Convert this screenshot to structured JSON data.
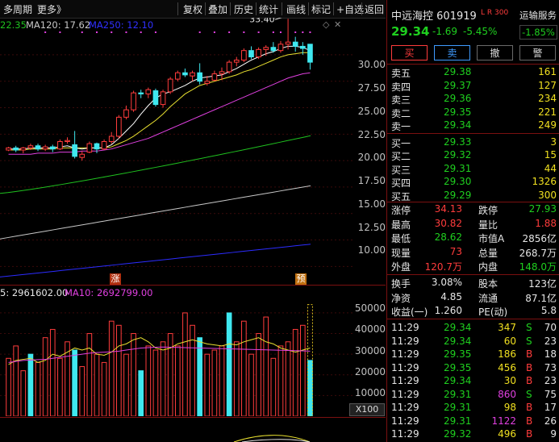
{
  "toolbar": {
    "left": [
      "多周期",
      "更多》"
    ],
    "right": [
      "复权",
      "叠加",
      "历史",
      "统计",
      "画线",
      "标记",
      "+自选",
      "返回"
    ]
  },
  "ma_legend": {
    "ma60_value": "22.35",
    "ma120": "MA120: 17.62",
    "ma250": "MA250: 12.10"
  },
  "price_axis": [
    "30.00",
    "27.50",
    "25.00",
    "22.50",
    "20.00",
    "17.50",
    "15.00",
    "12.50",
    "10.00"
  ],
  "annotations": {
    "high_label": "33.40",
    "marker_zhang": "涨",
    "marker_yu": "预"
  },
  "volume_legend": {
    "ma5": "5: 2961602.00",
    "ma10": "MA10: 2692799.00"
  },
  "volume_axis": [
    "50000",
    "40000",
    "30000",
    "20000",
    "10000"
  ],
  "volume_unit": "X100",
  "colors": {
    "up": "#ff3c3c",
    "down": "#3fe8f0",
    "ma5": "#ffffff",
    "ma10": "#e8e030",
    "ma20": "#e040e0",
    "ma60": "#1fc01f",
    "ma120": "#c8c8c8",
    "ma250": "#2c2cff"
  },
  "stock": {
    "name": "中远海控",
    "code": "601919",
    "flags": "L R",
    "flag_num": "300",
    "sector": "运输服务",
    "sector_change": "-1.85%",
    "price": "29.34",
    "change": "-1.69",
    "change_pct": "-5.45%"
  },
  "actions": [
    "买",
    "卖",
    "撤",
    "警"
  ],
  "asks": [
    {
      "label": "卖五",
      "price": "29.38",
      "vol": "161"
    },
    {
      "label": "卖四",
      "price": "29.37",
      "vol": "127"
    },
    {
      "label": "卖三",
      "price": "29.36",
      "vol": "234"
    },
    {
      "label": "卖二",
      "price": "29.35",
      "vol": "221"
    },
    {
      "label": "卖一",
      "price": "29.34",
      "vol": "249"
    }
  ],
  "bids": [
    {
      "label": "买一",
      "price": "29.33",
      "vol": "3"
    },
    {
      "label": "买二",
      "price": "29.32",
      "vol": "15"
    },
    {
      "label": "买三",
      "price": "29.31",
      "vol": "44"
    },
    {
      "label": "买四",
      "price": "29.30",
      "vol": "1326"
    },
    {
      "label": "买五",
      "price": "29.29",
      "vol": "300"
    }
  ],
  "stats": [
    {
      "l1": "涨停",
      "v1": "34.13",
      "c1": "red",
      "l2": "跌停",
      "v2": "27.93",
      "c2": "grn"
    },
    {
      "l1": "最高",
      "v1": "30.82",
      "c1": "red",
      "l2": "量比",
      "v2": "1.88",
      "c2": "red"
    },
    {
      "l1": "最低",
      "v1": "28.62",
      "c1": "grn",
      "l2": "市值A",
      "v2": "2856亿",
      "c2": "wht"
    },
    {
      "l1": "现量",
      "v1": "73",
      "c1": "red",
      "l2": "总量",
      "v2": "268.7万",
      "c2": "wht"
    },
    {
      "l1": "外盘",
      "v1": "120.7万",
      "c1": "red",
      "l2": "内盘",
      "v2": "148.0万",
      "c2": "grn"
    }
  ],
  "stats2": [
    {
      "l1": "换手",
      "v1": "3.08%",
      "l2": "股本",
      "v2": "123亿"
    },
    {
      "l1": "净资",
      "v1": "4.85",
      "l2": "流通",
      "v2": "87.1亿"
    },
    {
      "l1": "收益(一)",
      "v1": "1.260",
      "l2": "PE(动)",
      "v2": "5.8"
    }
  ],
  "ticks": [
    {
      "time": "11:29",
      "price": "29.34",
      "vol": "347",
      "side": "S",
      "n": "70",
      "vc": "yel",
      "sc": "grn"
    },
    {
      "time": "11:29",
      "price": "29.34",
      "vol": "60",
      "side": "S",
      "n": "23",
      "vc": "yel",
      "sc": "grn"
    },
    {
      "time": "11:29",
      "price": "29.35",
      "vol": "186",
      "side": "B",
      "n": "18",
      "vc": "yel",
      "sc": "red"
    },
    {
      "time": "11:29",
      "price": "29.35",
      "vol": "456",
      "side": "B",
      "n": "73",
      "vc": "yel",
      "sc": "red"
    },
    {
      "time": "11:29",
      "price": "29.34",
      "vol": "30",
      "side": "B",
      "n": "23",
      "vc": "yel",
      "sc": "red"
    },
    {
      "time": "11:29",
      "price": "29.31",
      "vol": "860",
      "side": "S",
      "n": "75",
      "vc": "mag",
      "sc": "grn"
    },
    {
      "time": "11:29",
      "price": "29.31",
      "vol": "98",
      "side": "B",
      "n": "17",
      "vc": "yel",
      "sc": "red"
    },
    {
      "time": "11:29",
      "price": "29.31",
      "vol": "1122",
      "side": "B",
      "n": "26",
      "vc": "mag",
      "sc": "red"
    },
    {
      "time": "11:29",
      "price": "29.32",
      "vol": "496",
      "side": "B",
      "n": "9",
      "vc": "yel",
      "sc": "red"
    }
  ],
  "chart_data": {
    "type": "candlestick",
    "price_ylim": [
      8.5,
      33.5
    ],
    "candles": [
      [
        21.0,
        21.3,
        20.9,
        21.2
      ],
      [
        21.2,
        21.4,
        20.8,
        21.0
      ],
      [
        21.0,
        21.3,
        20.7,
        21.2
      ],
      [
        21.2,
        21.6,
        21.0,
        21.4
      ],
      [
        21.4,
        21.6,
        20.9,
        21.1
      ],
      [
        21.1,
        21.5,
        20.9,
        21.3
      ],
      [
        21.3,
        21.5,
        20.8,
        21.1
      ],
      [
        21.1,
        22.0,
        21.0,
        21.8
      ],
      [
        21.8,
        22.2,
        21.6,
        21.9
      ],
      [
        21.5,
        22.8,
        20.2,
        20.4
      ],
      [
        20.3,
        20.9,
        20.0,
        20.6
      ],
      [
        20.8,
        21.8,
        20.7,
        21.6
      ],
      [
        21.6,
        21.7,
        20.7,
        21.1
      ],
      [
        21.1,
        22.0,
        21.0,
        21.8
      ],
      [
        21.8,
        22.7,
        21.6,
        22.3
      ],
      [
        22.3,
        24.3,
        22.1,
        24.1
      ],
      [
        24.1,
        25.2,
        23.9,
        24.8
      ],
      [
        24.8,
        26.6,
        24.6,
        26.4
      ],
      [
        26.4,
        26.7,
        25.9,
        26.3
      ],
      [
        26.3,
        26.9,
        25.9,
        26.7
      ],
      [
        26.6,
        26.8,
        25.1,
        25.3
      ],
      [
        25.3,
        26.7,
        25.0,
        26.5
      ],
      [
        26.5,
        27.9,
        26.3,
        27.7
      ],
      [
        27.7,
        28.5,
        27.5,
        28.3
      ],
      [
        28.3,
        28.7,
        27.9,
        28.1
      ],
      [
        28.0,
        28.5,
        27.5,
        28.3
      ],
      [
        28.3,
        29.2,
        27.2,
        27.5
      ],
      [
        27.3,
        28.0,
        27.1,
        27.5
      ],
      [
        27.6,
        28.5,
        27.5,
        28.2
      ],
      [
        28.2,
        28.8,
        27.6,
        28.4
      ],
      [
        28.4,
        29.5,
        28.2,
        29.3
      ],
      [
        29.3,
        29.8,
        28.9,
        29.5
      ],
      [
        29.5,
        30.6,
        29.3,
        30.4
      ],
      [
        30.4,
        30.8,
        29.6,
        29.8
      ],
      [
        29.8,
        30.7,
        29.6,
        30.5
      ],
      [
        30.5,
        30.9,
        29.9,
        30.7
      ],
      [
        30.7,
        31.2,
        30.2,
        30.4
      ],
      [
        30.4,
        31.3,
        30.2,
        31.0
      ],
      [
        31.0,
        33.4,
        30.5,
        31.2
      ],
      [
        31.2,
        31.7,
        30.3,
        30.8
      ],
      [
        30.8,
        31.2,
        30.0,
        30.6
      ],
      [
        31.0,
        31.0,
        28.6,
        29.3
      ]
    ],
    "ma5": [
      21.1,
      21.1,
      21.1,
      21.2,
      21.2,
      21.2,
      21.2,
      21.3,
      21.4,
      21.2,
      21.1,
      21.2,
      21.2,
      21.2,
      21.5,
      22.1,
      22.8,
      23.5,
      24.4,
      25.2,
      25.9,
      26.3,
      26.5,
      26.8,
      27.1,
      27.5,
      27.8,
      27.9,
      28.0,
      28.1,
      28.4,
      28.7,
      29.1,
      29.5,
      29.8,
      30.1,
      30.3,
      30.6,
      30.8,
      30.8,
      30.7,
      30.4
    ],
    "ma10": [
      21.0,
      21.0,
      21.0,
      21.1,
      21.1,
      21.1,
      21.1,
      21.2,
      21.2,
      21.2,
      21.2,
      21.2,
      21.2,
      21.2,
      21.3,
      21.6,
      21.9,
      22.3,
      22.8,
      23.3,
      23.8,
      24.4,
      25.1,
      25.7,
      26.3,
      26.7,
      27.1,
      27.3,
      27.5,
      27.7,
      27.9,
      28.1,
      28.4,
      28.6,
      28.9,
      29.2,
      29.5,
      29.8,
      30.0,
      30.1,
      30.2,
      30.2
    ],
    "ma20": [
      20.6,
      20.6,
      20.6,
      20.6,
      20.7,
      20.7,
      20.7,
      20.8,
      20.8,
      20.8,
      20.9,
      20.9,
      20.9,
      21.0,
      21.1,
      21.3,
      21.5,
      21.7,
      21.9,
      22.1,
      22.4,
      22.7,
      23.0,
      23.3,
      23.6,
      23.9,
      24.2,
      24.5,
      24.8,
      25.1,
      25.4,
      25.7,
      26.0,
      26.3,
      26.6,
      26.9,
      27.2,
      27.5,
      27.8,
      28.0,
      28.2,
      28.3
    ],
    "ma60_range": [
      16.9,
      22.35
    ],
    "ma120_range": [
      12.6,
      17.62
    ],
    "ma250_range": [
      9.0,
      12.1
    ],
    "volume_ylim": [
      0,
      57000
    ],
    "volume": [
      28000,
      34000,
      22000,
      30000,
      26000,
      38000,
      42000,
      28000,
      36000,
      32000,
      24000,
      40000,
      30000,
      26000,
      46000,
      44000,
      30000,
      40000,
      22000,
      34000,
      32000,
      36000,
      40000,
      34000,
      50000,
      44000,
      38000,
      30000,
      32000,
      34000,
      50000,
      36000,
      46000,
      30000,
      40000,
      48000,
      28000,
      34000,
      36000,
      42000,
      44000,
      27000
    ],
    "volume_up": [
      1,
      1,
      1,
      0,
      1,
      1,
      1,
      1,
      1,
      0,
      1,
      1,
      1,
      1,
      1,
      1,
      1,
      1,
      0,
      1,
      1,
      1,
      1,
      1,
      1,
      1,
      0,
      1,
      1,
      1,
      0,
      1,
      1,
      1,
      1,
      1,
      1,
      1,
      1,
      1,
      1,
      0
    ],
    "vol_ma5": [
      25000,
      27000,
      27500,
      28000,
      26000,
      27000,
      30000,
      29000,
      31000,
      33000,
      32000,
      33000,
      30000,
      29500,
      31000,
      34000,
      35000,
      37000,
      38000,
      36000,
      33000,
      32000,
      33000,
      35000,
      36000,
      37000,
      36000,
      35000,
      34500,
      34000,
      35000,
      34500,
      36000,
      37000,
      38000,
      36000,
      35000,
      33000,
      32000,
      31000,
      32000,
      33000
    ],
    "vol_ma10": [
      26000,
      26500,
      27000,
      27200,
      27400,
      27500,
      28000,
      28500,
      29000,
      29500,
      30000,
      30500,
      30800,
      31000,
      31200,
      31500,
      32000,
      32500,
      33000,
      33200,
      33400,
      33500,
      33400,
      33300,
      33200,
      33100,
      33000,
      32900,
      32800,
      32700,
      32600,
      32500,
      32400,
      32300,
      32200,
      32100,
      32000,
      31900,
      31800,
      31700,
      31600,
      31500
    ]
  }
}
